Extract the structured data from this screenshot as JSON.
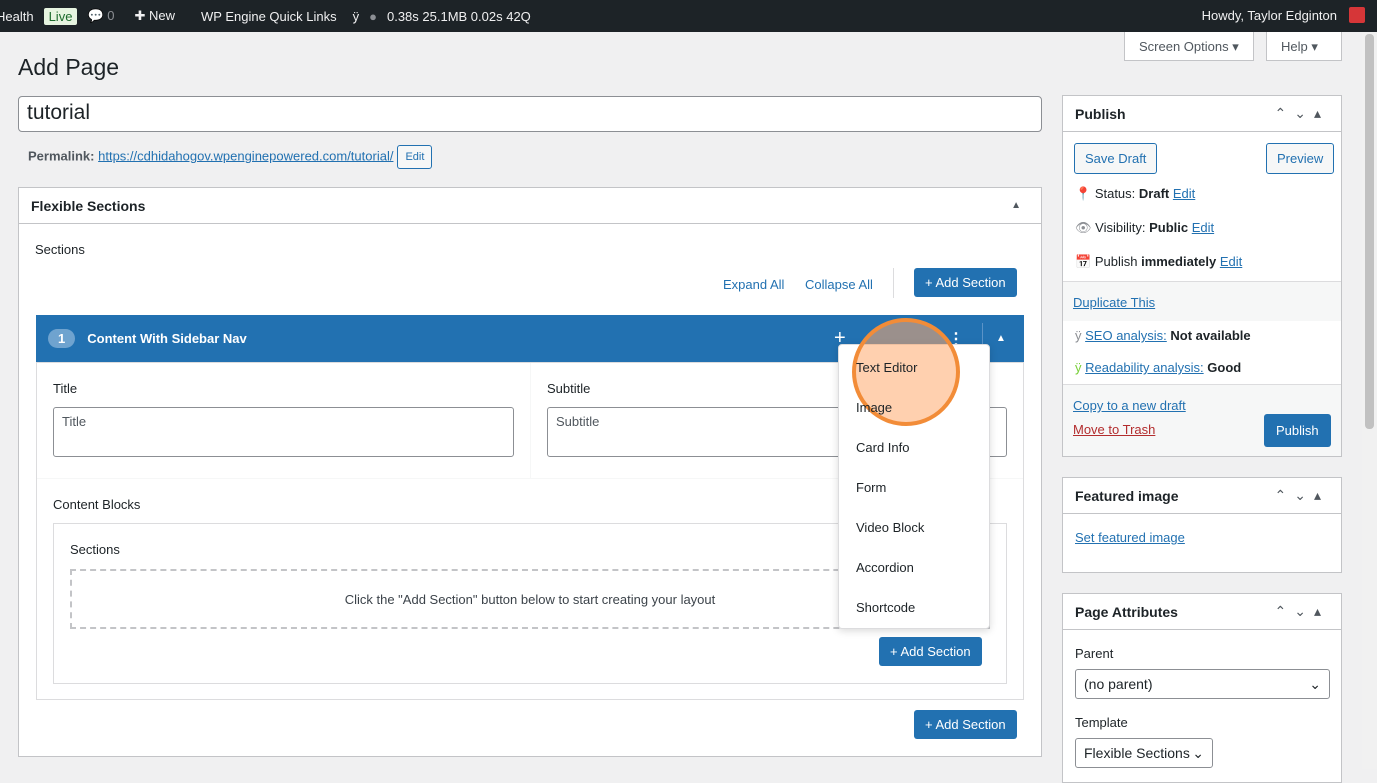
{
  "adminbar": {
    "health": "Health",
    "live": "Live",
    "comments": "0",
    "new": "New",
    "quick_links": "WP Engine Quick Links",
    "stats": "0.38s 25.1MB 0.02s 42Q",
    "howdy": "Howdy, Taylor Edginton"
  },
  "screen_options": "Screen Options ▾",
  "help": "Help ▾",
  "page_title": "Add Page",
  "post_title": "tutorial",
  "permalink": {
    "label": "Permalink:",
    "url": "https://cdhidahogov.wpenginepowered.com/tutorial/",
    "edit": "Edit"
  },
  "flex": {
    "title": "Flexible Sections",
    "sections_label": "Sections",
    "expand_all": "Expand All",
    "collapse_all": "Collapse All",
    "add_section": "+ Add Section",
    "section": {
      "number": "1",
      "name": "Content With Sidebar Nav",
      "title_label": "Title",
      "title_placeholder": "Title",
      "subtitle_label": "Subtitle",
      "subtitle_placeholder": "Subtitle",
      "content_blocks": "Content Blocks",
      "inner_sections": "Sections",
      "empty_msg": "Click the \"Add Section\" button below to start creating your layout"
    }
  },
  "menu": [
    "Text Editor",
    "Image",
    "Card Info",
    "Form",
    "Video Block",
    "Accordion",
    "Shortcode"
  ],
  "publish": {
    "title": "Publish",
    "save_draft": "Save Draft",
    "preview": "Preview",
    "status_label": "Status:",
    "status": "Draft",
    "visibility_label": "Visibility:",
    "visibility": "Public",
    "publish_label": "Publish",
    "publish_when": "immediately",
    "edit": "Edit",
    "duplicate": "Duplicate This",
    "seo_label": "SEO analysis:",
    "seo": "Not available",
    "read_label": "Readability analysis:",
    "read": "Good",
    "copy": "Copy to a new draft",
    "trash": "Move to Trash",
    "publish_btn": "Publish"
  },
  "featured": {
    "title": "Featured image",
    "set": "Set featured image"
  },
  "attributes": {
    "title": "Page Attributes",
    "parent_label": "Parent",
    "parent": "(no parent)",
    "template_label": "Template",
    "template": "Flexible Sections"
  }
}
